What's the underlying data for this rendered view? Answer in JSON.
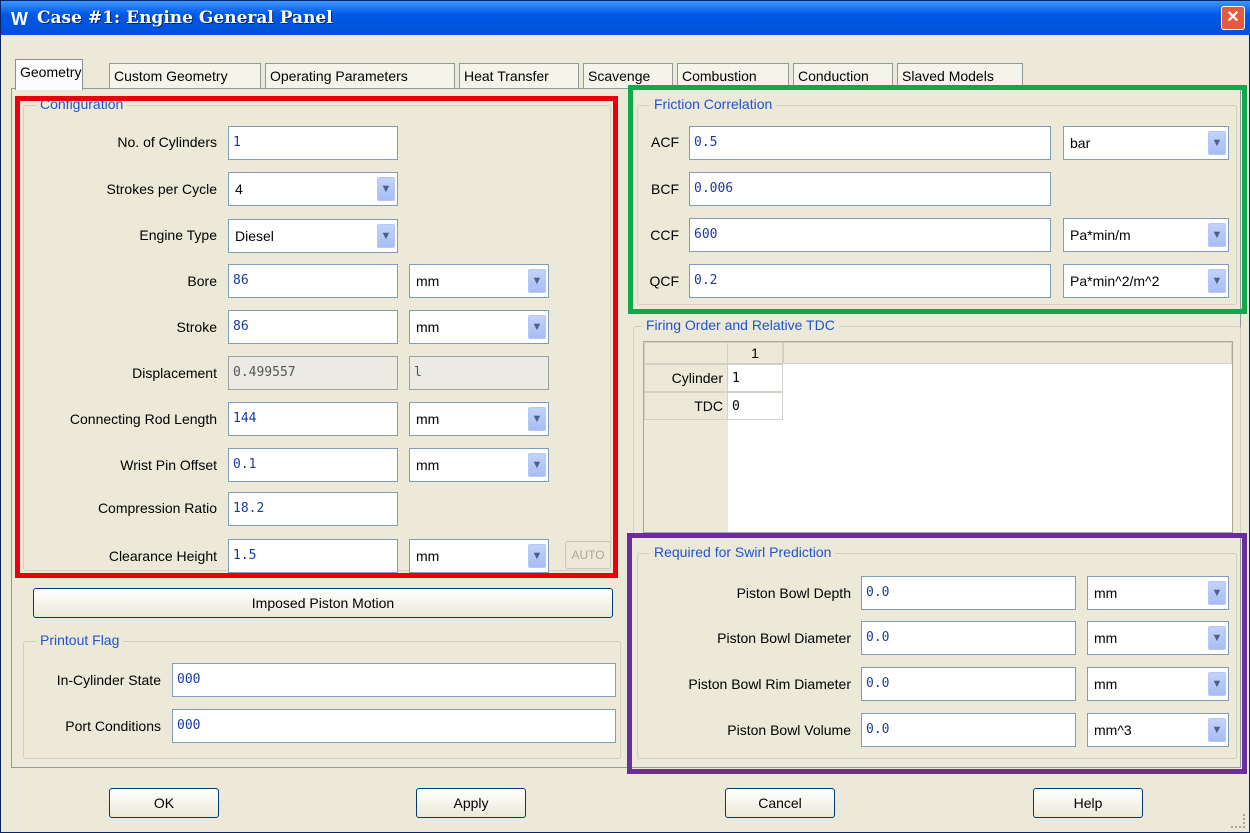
{
  "window": {
    "title": "Case #1: Engine General Panel",
    "icon": "W"
  },
  "tabs": [
    {
      "label": "Geometry",
      "active": true
    },
    {
      "label": "Custom Geometry"
    },
    {
      "label": "Operating Parameters"
    },
    {
      "label": "Heat Transfer"
    },
    {
      "label": "Scavenge"
    },
    {
      "label": "Combustion"
    },
    {
      "label": "Conduction"
    },
    {
      "label": "Slaved Models"
    }
  ],
  "configuration": {
    "title": "Configuration",
    "cylinders": {
      "label": "No. of Cylinders",
      "value": "1"
    },
    "strokes": {
      "label": "Strokes per Cycle",
      "value": "4"
    },
    "engine_type": {
      "label": "Engine Type",
      "value": "Diesel"
    },
    "bore": {
      "label": "Bore",
      "value": "86",
      "unit": "mm"
    },
    "stroke": {
      "label": "Stroke",
      "value": "86",
      "unit": "mm"
    },
    "displacement": {
      "label": "Displacement",
      "value": "0.499557",
      "unit": "l"
    },
    "rod_length": {
      "label": "Connecting Rod Length",
      "value": "144",
      "unit": "mm"
    },
    "wrist_pin": {
      "label": "Wrist Pin Offset",
      "value": "0.1",
      "unit": "mm"
    },
    "compression": {
      "label": "Compression Ratio",
      "value": "18.2"
    },
    "clearance": {
      "label": "Clearance Height",
      "value": "1.5",
      "unit": "mm",
      "auto": "AUTO"
    }
  },
  "imposed_button": "Imposed Piston Motion",
  "printout": {
    "title": "Printout Flag",
    "in_cylinder": {
      "label": "In-Cylinder State",
      "value": "000"
    },
    "port": {
      "label": "Port Conditions",
      "value": "000"
    }
  },
  "friction": {
    "title": "Friction Correlation",
    "acf": {
      "label": "ACF",
      "value": "0.5",
      "unit": "bar"
    },
    "bcf": {
      "label": "BCF",
      "value": "0.006"
    },
    "ccf": {
      "label": "CCF",
      "value": "600",
      "unit": "Pa*min/m"
    },
    "qcf": {
      "label": "QCF",
      "value": "0.2",
      "unit": "Pa*min^2/m^2"
    }
  },
  "firing": {
    "title": "Firing Order and Relative TDC",
    "col_header": "1",
    "rows": [
      {
        "label": "Cylinder",
        "value": "1"
      },
      {
        "label": "TDC",
        "value": "0"
      }
    ]
  },
  "swirl": {
    "title": "Required for Swirl Prediction",
    "depth": {
      "label": "Piston Bowl Depth",
      "value": "0.0",
      "unit": "mm"
    },
    "diameter": {
      "label": "Piston Bowl Diameter",
      "value": "0.0",
      "unit": "mm"
    },
    "rim": {
      "label": "Piston Bowl Rim Diameter",
      "value": "0.0",
      "unit": "mm"
    },
    "volume": {
      "label": "Piston Bowl Volume",
      "value": "0.0",
      "unit": "mm^3"
    }
  },
  "buttons": {
    "ok": "OK",
    "apply": "Apply",
    "cancel": "Cancel",
    "help": "Help"
  },
  "colors": {
    "config_box": "#e8000b",
    "friction_box": "#10a84a",
    "swirl_box": "#6a2d9c",
    "group_title": "#1f54d0"
  },
  "icons": {
    "close": "close-icon",
    "dropdown": "chevron-down-icon"
  }
}
